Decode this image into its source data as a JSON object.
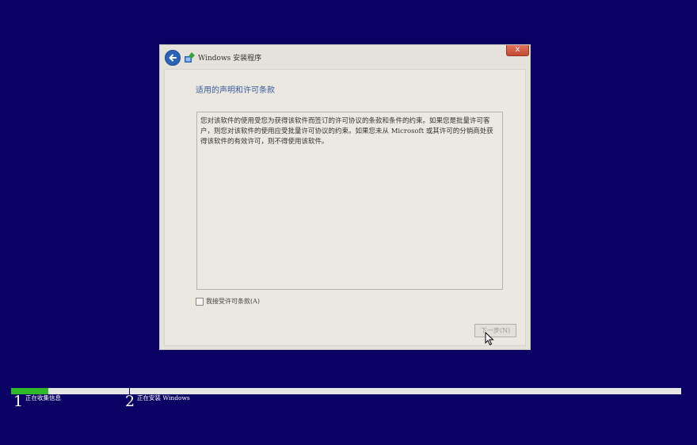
{
  "window": {
    "title": "Windows 安装程序",
    "close_label": "x"
  },
  "page": {
    "title": "适用的声明和许可条款",
    "license_text": "您对该软件的使用受您为获得该软件而签订的许可协议的条款和条件的约束。如果您是批量许可客户，则您对该软件的使用应受批量许可协议的约束。如果您未从 Microsoft 或其许可的分销商处获得该软件的有效许可，则不得使用该软件。",
    "accept_label": "我接受许可条款(A)",
    "accept_checked": false,
    "next_label": "下一步(N)",
    "next_enabled": false
  },
  "progress": {
    "fraction": 0.056,
    "steps": [
      {
        "number": "1",
        "label": "正在收集信息"
      },
      {
        "number": "2",
        "label": "正在安装 Windows"
      }
    ]
  },
  "colors": {
    "background": "#0a0164",
    "progress_fill": "#2fbb29",
    "accent": "#2a64b8"
  }
}
